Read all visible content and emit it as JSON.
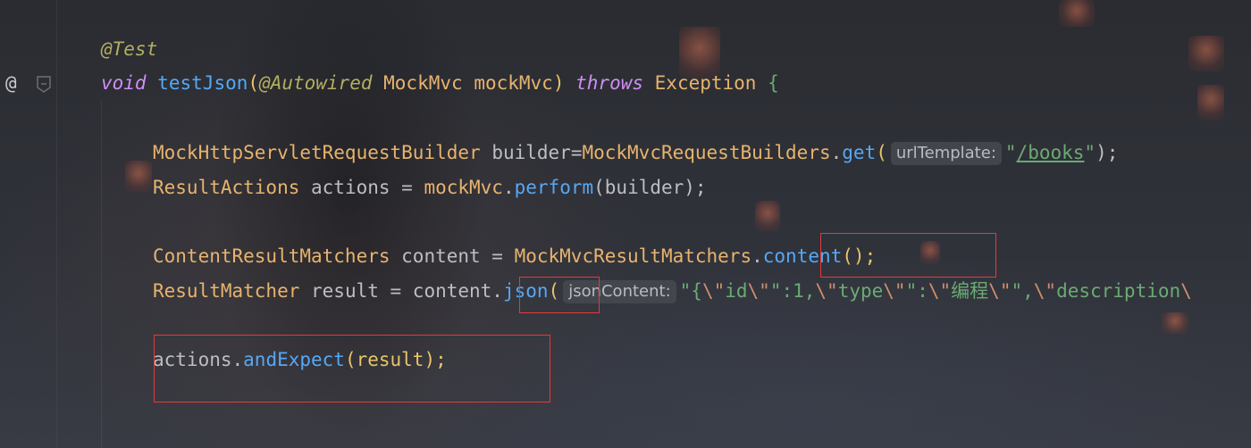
{
  "editor": {
    "gutter": {
      "at_symbol": "@"
    },
    "code": {
      "annotation": "@Test",
      "sig_void": "void",
      "sig_name": "testJson",
      "sig_paren_open": "(",
      "sig_param_ann": "@Autowired",
      "sig_param_type": "MockMvc",
      "sig_param_name": "mockMvc",
      "sig_paren_close": ")",
      "sig_throws": "throws",
      "sig_exception": "Exception",
      "sig_brace": "{",
      "l3_type": "MockHttpServletRequestBuilder",
      "l3_var": "builder=",
      "l3_class": "MockMvcRequestBuilders",
      "l3_dot": ".",
      "l3_method": "get",
      "l3_po": "(",
      "l3_hint": "urlTemplate:",
      "l3_q1": "\"",
      "l3_url": "/books",
      "l3_q2": "\"",
      "l3_end": ");",
      "l4_type": "ResultActions",
      "l4_rest": " actions = ",
      "l4_obj": "mockMvc",
      "l4_dot": ".",
      "l4_method": "perform",
      "l4_args": "(builder);",
      "l6_type": "ContentResultMatchers",
      "l6_rest": " content = ",
      "l6_class": "MockMvcResultMatchers",
      "l6_dot": ".",
      "l6_method": "content",
      "l6_end": "();",
      "l7_type": "ResultMatcher",
      "l7_rest": " result = content.",
      "l7_method": "json",
      "l7_po": "(",
      "l7_hint": "jsonContent:",
      "l7_s1": "\"{",
      "l7_e1": "\\\"",
      "l7_s2": "id",
      "l7_e2": "\\\"",
      "l7_s3": "\":1,",
      "l7_e3": "\\\"",
      "l7_s4": "type",
      "l7_e4": "\\\"",
      "l7_s5": "\":",
      "l7_e5": "\\\"",
      "l7_s6": "编程",
      "l7_e6": "\\\"",
      "l7_s7": "\",",
      "l7_e7": "\\\"",
      "l7_s8": "description",
      "l7_e8": "\\",
      "l9_obj": "actions.",
      "l9_method": "andExpect",
      "l9_args": "(result);"
    }
  },
  "colors": {
    "highlight_box": "#e23b3b",
    "annotation": "#b3ae60",
    "keyword": "#cf8ef4",
    "method": "#56a8f5",
    "type": "#e7b36e",
    "string": "#6aab73"
  }
}
